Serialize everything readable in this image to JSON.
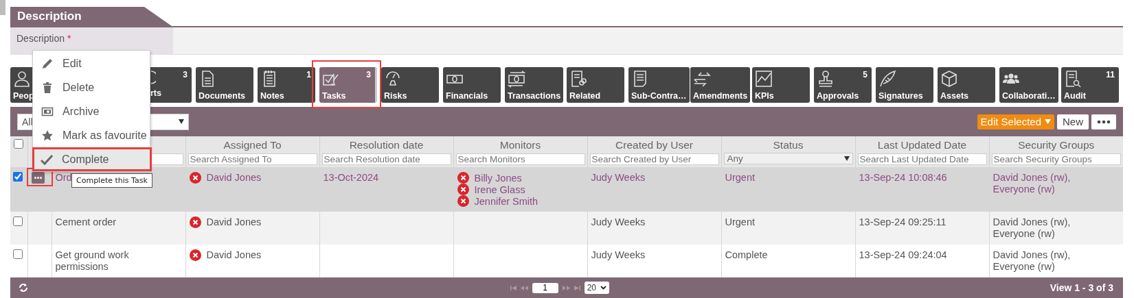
{
  "section": {
    "title": "Description"
  },
  "field": {
    "label": "Description",
    "required_mark": "*"
  },
  "tiles": [
    {
      "label": "Peop",
      "kind": "partial_right",
      "selected": false,
      "highlighted": false
    },
    {
      "label": "rts",
      "count": "3",
      "kind": "partial_left",
      "selected": false,
      "highlighted": false
    },
    {
      "label": "Documents",
      "kind": "full",
      "selected": false,
      "highlighted": false
    },
    {
      "label": "Notes",
      "count": "1",
      "kind": "full",
      "selected": false,
      "highlighted": false
    },
    {
      "label": "Tasks",
      "count": "3",
      "kind": "full",
      "selected": true,
      "highlighted": true
    },
    {
      "label": "Risks",
      "kind": "full",
      "selected": false,
      "highlighted": false
    },
    {
      "label": "Financials",
      "kind": "full",
      "selected": false,
      "highlighted": false
    },
    {
      "label": "Transactions",
      "kind": "full",
      "selected": false,
      "highlighted": false
    },
    {
      "label": "Related",
      "kind": "full",
      "selected": false,
      "highlighted": false
    },
    {
      "label": "Sub-Contra…",
      "kind": "full",
      "selected": false,
      "highlighted": false
    },
    {
      "label": "Amendments",
      "kind": "full",
      "selected": false,
      "highlighted": false
    },
    {
      "label": "KPIs",
      "kind": "full",
      "selected": false,
      "highlighted": false
    },
    {
      "label": "Approvals",
      "count": "5",
      "kind": "full",
      "selected": false,
      "highlighted": false
    },
    {
      "label": "Signatures",
      "kind": "full",
      "selected": false,
      "highlighted": false
    },
    {
      "label": "Assets",
      "kind": "full",
      "selected": false,
      "highlighted": false
    },
    {
      "label": "Collaborati…",
      "kind": "full",
      "selected": false,
      "highlighted": false
    },
    {
      "label": "Audit",
      "count": "11",
      "kind": "full",
      "selected": false,
      "highlighted": false
    }
  ],
  "toolbar": {
    "filter_value": "All",
    "edit_button": "Edit Selected",
    "new_button": "New"
  },
  "menu": {
    "items": [
      {
        "label": "Edit",
        "highlighted": false
      },
      {
        "label": "Delete",
        "highlighted": false
      },
      {
        "label": "Archive",
        "highlighted": false
      },
      {
        "label": "Mark as favourite",
        "highlighted": false
      },
      {
        "label": "Complete",
        "highlighted": true
      }
    ]
  },
  "tooltip": "Complete this Task",
  "table": {
    "header_checked": false,
    "columns": [
      {
        "label": "Assigned To",
        "kind": "search",
        "placeholder": "Search Assigned To"
      },
      {
        "label": "Resolution date",
        "kind": "search",
        "placeholder": "Search Resolution date"
      },
      {
        "label": "Monitors",
        "kind": "search",
        "placeholder": "Search Monitors"
      },
      {
        "label": "Created by User",
        "kind": "search",
        "placeholder": "Search Created by User"
      },
      {
        "label": "Status",
        "kind": "select",
        "value": "Any"
      },
      {
        "label": "Last Updated Date",
        "kind": "search",
        "placeholder": "Search Last Updated Date"
      },
      {
        "label": "Security Groups",
        "kind": "search",
        "placeholder": "Search Security Groups"
      }
    ],
    "rows": [
      {
        "checked": true,
        "selected": true,
        "menu_button": true,
        "menu_button_highlighted": true,
        "name": "Ord",
        "assigned_to": "David Jones",
        "resolution_date": "13-Oct-2024",
        "monitors": [
          "Billy Jones",
          "Irene Glass",
          "Jennifer Smith"
        ],
        "created_by": "Judy Weeks",
        "status": "Urgent",
        "last_updated": "13-Sep-24 10:08:46",
        "security_groups": "David Jones (rw), Everyone (rw)"
      },
      {
        "checked": false,
        "selected": false,
        "menu_button": false,
        "menu_button_highlighted": false,
        "name": "Cement order",
        "assigned_to": "David Jones",
        "monitors": [],
        "created_by": "Judy Weeks",
        "status": "Urgent",
        "last_updated": "13-Sep-24 09:25:11",
        "security_groups": "David Jones (rw), Everyone (rw)"
      },
      {
        "checked": false,
        "selected": false,
        "menu_button": false,
        "menu_button_highlighted": false,
        "name": "Get ground work permissions",
        "assigned_to": "David Jones",
        "monitors": [],
        "created_by": "Judy Weeks",
        "status": "Complete",
        "last_updated": "13-Sep-24 09:24:04",
        "security_groups": "David Jones (rw), Everyone (rw)"
      }
    ]
  },
  "pager": {
    "page": "1",
    "page_size": "20",
    "summary": "View 1 - 3 of 3"
  }
}
